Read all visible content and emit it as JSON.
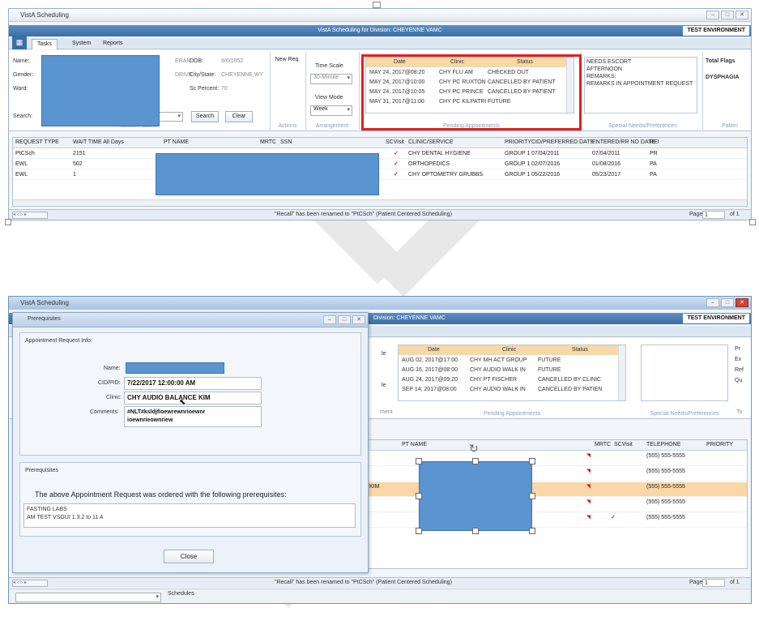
{
  "app_title": "VistA Scheduling",
  "division_banner": "VistA Scheduling for Division: CHEYENNE VAMC",
  "division_banner_short": "Division: CHEYENNE VAMC",
  "test_environment": "TEST ENVIRONMENT",
  "tabs": [
    "Tasks",
    "System",
    "Reports"
  ],
  "patient": {
    "name_label": "Name:",
    "gender_label": "Gender:",
    "ward_label": "Ward:",
    "search_label": "Search:",
    "veteran_fragment": "ERAN",
    "address_fragment": "DRIVE",
    "dob_label": "DOB:",
    "dob_value": "9/6/1952",
    "city_label": "City/State:",
    "city_value": "CHEYENNE,WY",
    "sc_label": "Sc Percent:",
    "sc_value": "70",
    "search_button": "Search",
    "clear_button": "Clear",
    "group_label": "Select Patient"
  },
  "actions": {
    "new_req": "New Req.",
    "group_label": "Actions"
  },
  "arrangement": {
    "time_scale_label": "Time Scale",
    "time_scale_value": "30-Minute",
    "view_mode_label": "View Mode",
    "view_mode_value": "Week",
    "group_label": "Arrangement"
  },
  "pending": {
    "headers": [
      "Date",
      "Clinic",
      "Status"
    ],
    "rows": [
      [
        "MAY 24, 2017@08:20",
        "CHY FLU AM",
        "CHECKED OUT"
      ],
      [
        "MAY 24, 2017@10:00",
        "CHY PC RUXTON",
        "CANCELLED BY PATIENT"
      ],
      [
        "MAY 24, 2017@10:05",
        "CHY PC PRINCE",
        "CANCELLED BY PATIENT"
      ],
      [
        "MAY 31, 2017@11:00",
        "CHY PC KILPATRI",
        "FUTURE"
      ]
    ],
    "group_label": "Pending Appointments"
  },
  "special_needs": {
    "lines": [
      "NEEDS ESCORT",
      "AFTERNOON",
      "REMARKS:",
      "   REMARKS IN APPOINTMENT REQUEST"
    ],
    "group_label": "Special Needs/Preferences"
  },
  "flags": {
    "title": "Total Flags",
    "item": "DYSPHAGIA",
    "group_label": "Patien"
  },
  "request_grid": {
    "headers": [
      "REQUEST TYPE",
      "WAIT TIME All Days",
      "PT NAME",
      "MRTC",
      "SSN",
      "SCVisit",
      "CLINIC/SERVICE",
      "PRIORITY",
      "CID/PREFERRED DATE",
      "ENTERED/RR NO DATE",
      "REI"
    ],
    "rows": [
      [
        "PtCSch",
        "2151",
        "✓",
        "CHY DENTAL HYGIENE",
        "GROUP 1",
        "07/04/2011",
        "07/04/2011",
        "PR"
      ],
      [
        "EWL",
        "502",
        "✓",
        "ORTHOPEDICS",
        "GROUP 1",
        "02/07/2016",
        "01/08/2016",
        "PA"
      ],
      [
        "EWL",
        "1",
        "✓",
        "CHY OPTOMETRY GRUBBS",
        "GROUP 1",
        "05/22/2016",
        "05/23/2017",
        "PA"
      ]
    ]
  },
  "status_message": "\"Recall\" has been renamed to \"PtCSch\" (Patient Centered Scheduling)",
  "page_label": "Page",
  "page_value": "1",
  "page_of": "of 1",
  "pending2": {
    "headers": [
      "Date",
      "Clinic",
      "Status"
    ],
    "rows": [
      [
        "AUG 02, 2017@17:00",
        "CHY MH ACT GROUP",
        "FUTURE"
      ],
      [
        "AUG 16, 2017@08:00",
        "CHY AUDIO WALK IN",
        "FUTURE"
      ],
      [
        "AUG 24, 2017@09:20",
        "CHY PT FISCHER",
        "CANCELLED BY CLINIC"
      ],
      [
        "SEP 14, 2017@08:00",
        "CHY AUDIO WALK IN",
        "CANCELLED BY PATIEN"
      ]
    ],
    "group_label": "Pending Appointments"
  },
  "special2_label": "Special Needs/Preferences",
  "grid2": {
    "headers": [
      "PT NAME",
      "MRTC",
      "SCVisit",
      "TELEPHONE",
      "PRIORITY"
    ],
    "phones": [
      "(555) 555-5555",
      "(555) 555-5555",
      "(555) 555-5555",
      "(555) 555-5555",
      "(555) 555-5555"
    ],
    "partial_km": "KIM"
  },
  "fragments": {
    "le": "le",
    "le2": "le",
    "ment": "ment",
    "p": "Pr",
    "ex": "Ex",
    "ref": "Ref",
    "q": "Qu",
    "to": "To"
  },
  "schedules_label": "Schedules",
  "dialog": {
    "title": "Prerequisites",
    "info_label": "Appointment Request Info:",
    "name_label": "Name:",
    "cid_label": "CID/PID:",
    "cid_value": "7/22/2017 12:00:00 AM",
    "clinic_label": "Clinic:",
    "clinic_value": "CHY AUDIO BALANCE KIM",
    "comments_label": "Comments:",
    "comments_line1": "#NLT#ksldjfioewrewnrioewnr",
    "comments_line2": "ioewnrieownriew",
    "prereq_label": "Prerequisites",
    "sentence": "The above Appointment Request was ordered with the following prerequisites:",
    "items": [
      "FASTING LABS",
      "AM TEST VSGUI 1.3.2 to 11.4"
    ],
    "close_button": "Close"
  }
}
